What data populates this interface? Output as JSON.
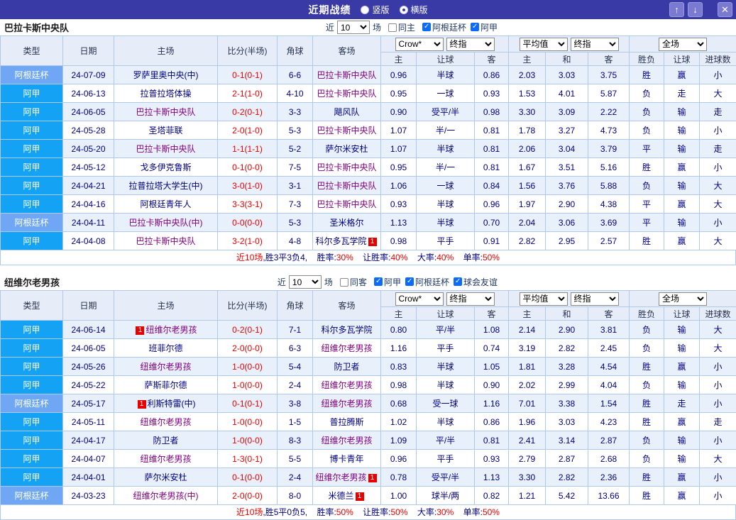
{
  "topbar": {
    "title": "近期战绩",
    "radios": [
      {
        "label": "竖版",
        "selected": false
      },
      {
        "label": "横版",
        "selected": true
      }
    ],
    "up_icon": "↑",
    "down_icon": "↓",
    "close_icon": "✕"
  },
  "table_header": {
    "type": "类型",
    "date": "日期",
    "home": "主场",
    "score": "比分(半场)",
    "corner": "角球",
    "away": "客场",
    "group1": {
      "dd1": "Crow*",
      "dd2": "终指"
    },
    "group2": {
      "dd1": "平均值",
      "dd2": "终指"
    },
    "group3": {
      "dd1": "全场"
    },
    "sub": [
      "主",
      "让球",
      "客",
      "主",
      "和",
      "客",
      "胜负",
      "让球",
      "进球数"
    ]
  },
  "sections": [
    {
      "team": "巴拉卡斯中央队",
      "filter": {
        "near": "近",
        "count": "10",
        "games": "场",
        "same": {
          "label": "同主",
          "checked": false
        },
        "leagues": [
          {
            "label": "阿根廷杯",
            "checked": true
          },
          {
            "label": "阿甲",
            "checked": true
          }
        ]
      },
      "rows": [
        {
          "type": "阿根廷杯",
          "cup": true,
          "date": "24-07-09",
          "home": {
            "name": "罗萨里奥中央(中)",
            "hl": false
          },
          "score": "0-1(0-1)",
          "corner": "6-6",
          "away": {
            "name": "巴拉卡斯中央队",
            "hl": true
          },
          "odds": [
            "0.96",
            "半球",
            "0.86",
            "2.03",
            "3.03",
            "3.75"
          ],
          "results": [
            [
              "胜",
              "r"
            ],
            [
              "赢",
              "r"
            ],
            [
              "小",
              "b"
            ]
          ]
        },
        {
          "type": "阿甲",
          "cup": false,
          "date": "24-06-13",
          "home": {
            "name": "拉普拉塔体操",
            "hl": false
          },
          "score": "2-1(1-0)",
          "corner": "4-10",
          "away": {
            "name": "巴拉卡斯中央队",
            "hl": true
          },
          "odds": [
            "0.95",
            "一球",
            "0.93",
            "1.53",
            "4.01",
            "5.87"
          ],
          "results": [
            [
              "负",
              "b"
            ],
            [
              "走",
              "g"
            ],
            [
              "大",
              "r"
            ]
          ]
        },
        {
          "type": "阿甲",
          "cup": false,
          "date": "24-06-05",
          "home": {
            "name": "巴拉卡斯中央队",
            "hl": true
          },
          "score": "0-2(0-1)",
          "corner": "3-3",
          "away": {
            "name": "飓风队",
            "hl": false
          },
          "odds": [
            "0.90",
            "受平/半",
            "0.98",
            "3.30",
            "3.09",
            "2.22"
          ],
          "results": [
            [
              "负",
              "b"
            ],
            [
              "输",
              "b"
            ],
            [
              "走",
              "g"
            ]
          ]
        },
        {
          "type": "阿甲",
          "cup": false,
          "date": "24-05-28",
          "home": {
            "name": "圣塔菲联",
            "hl": false
          },
          "score": "2-0(1-0)",
          "corner": "5-3",
          "away": {
            "name": "巴拉卡斯中央队",
            "hl": true
          },
          "odds": [
            "1.07",
            "半/一",
            "0.81",
            "1.78",
            "3.27",
            "4.73"
          ],
          "results": [
            [
              "负",
              "b"
            ],
            [
              "输",
              "b"
            ],
            [
              "小",
              "b"
            ]
          ]
        },
        {
          "type": "阿甲",
          "cup": false,
          "date": "24-05-20",
          "home": {
            "name": "巴拉卡斯中央队",
            "hl": true
          },
          "score": "1-1(1-1)",
          "corner": "5-2",
          "away": {
            "name": "萨尔米安杜",
            "hl": false
          },
          "odds": [
            "1.07",
            "半球",
            "0.81",
            "2.06",
            "3.04",
            "3.79"
          ],
          "results": [
            [
              "平",
              "b"
            ],
            [
              "输",
              "b"
            ],
            [
              "走",
              "g"
            ]
          ]
        },
        {
          "type": "阿甲",
          "cup": false,
          "date": "24-05-12",
          "home": {
            "name": "戈多伊克鲁斯",
            "hl": false
          },
          "score": "0-1(0-0)",
          "corner": "7-5",
          "away": {
            "name": "巴拉卡斯中央队",
            "hl": true
          },
          "odds": [
            "0.95",
            "半/一",
            "0.81",
            "1.67",
            "3.51",
            "5.16"
          ],
          "results": [
            [
              "胜",
              "r"
            ],
            [
              "赢",
              "r"
            ],
            [
              "小",
              "b"
            ]
          ]
        },
        {
          "type": "阿甲",
          "cup": false,
          "date": "24-04-21",
          "home": {
            "name": "拉普拉塔大学生(中)",
            "hl": false
          },
          "score": "3-0(1-0)",
          "corner": "3-1",
          "away": {
            "name": "巴拉卡斯中央队",
            "hl": true
          },
          "odds": [
            "1.06",
            "一球",
            "0.84",
            "1.56",
            "3.76",
            "5.88"
          ],
          "results": [
            [
              "负",
              "b"
            ],
            [
              "输",
              "b"
            ],
            [
              "大",
              "r"
            ]
          ]
        },
        {
          "type": "阿甲",
          "cup": false,
          "date": "24-04-16",
          "home": {
            "name": "阿根廷青年人",
            "hl": false
          },
          "score": "3-3(3-1)",
          "corner": "7-3",
          "away": {
            "name": "巴拉卡斯中央队",
            "hl": true
          },
          "odds": [
            "0.93",
            "半球",
            "0.96",
            "1.97",
            "2.90",
            "4.38"
          ],
          "results": [
            [
              "平",
              "b"
            ],
            [
              "赢",
              "r"
            ],
            [
              "大",
              "r"
            ]
          ]
        },
        {
          "type": "阿根廷杯",
          "cup": true,
          "date": "24-04-11",
          "home": {
            "name": "巴拉卡斯中央队(中)",
            "hl": true
          },
          "score": "0-0(0-0)",
          "corner": "5-3",
          "away": {
            "name": "圣米格尔",
            "hl": false
          },
          "odds": [
            "1.13",
            "半球",
            "0.70",
            "2.04",
            "3.06",
            "3.69"
          ],
          "results": [
            [
              "平",
              "b"
            ],
            [
              "输",
              "b"
            ],
            [
              "小",
              "b"
            ]
          ]
        },
        {
          "type": "阿甲",
          "cup": false,
          "date": "24-04-08",
          "home": {
            "name": "巴拉卡斯中央队",
            "hl": true
          },
          "score": "3-2(1-0)",
          "corner": "4-8",
          "away": {
            "name": "科尔多瓦学院",
            "hl": false,
            "card_post": "1"
          },
          "odds": [
            "0.98",
            "平手",
            "0.91",
            "2.82",
            "2.95",
            "2.57"
          ],
          "results": [
            [
              "胜",
              "r"
            ],
            [
              "赢",
              "r"
            ],
            [
              "大",
              "r"
            ]
          ]
        }
      ],
      "summary": {
        "prefix": "近10场",
        "record": ",胜3平3负4,",
        "stats": [
          {
            "label": "胜率:",
            "value": "30%"
          },
          {
            "label": "让胜率:",
            "value": "40%"
          },
          {
            "label": "大率:",
            "value": "40%"
          },
          {
            "label": "单率:",
            "value": "50%"
          }
        ]
      }
    },
    {
      "team": "纽维尔老男孩",
      "filter": {
        "near": "近",
        "count": "10",
        "games": "场",
        "same": {
          "label": "同客",
          "checked": false
        },
        "leagues": [
          {
            "label": "阿甲",
            "checked": true
          },
          {
            "label": "阿根廷杯",
            "checked": true
          },
          {
            "label": "球会友谊",
            "checked": true
          }
        ]
      },
      "rows": [
        {
          "type": "阿甲",
          "cup": false,
          "date": "24-06-14",
          "home": {
            "name": "纽维尔老男孩",
            "hl": true,
            "card_pre": "1"
          },
          "score": "0-2(0-1)",
          "corner": "7-1",
          "away": {
            "name": "科尔多瓦学院",
            "hl": false
          },
          "odds": [
            "0.80",
            "平/半",
            "1.08",
            "2.14",
            "2.90",
            "3.81"
          ],
          "results": [
            [
              "负",
              "b"
            ],
            [
              "输",
              "b"
            ],
            [
              "大",
              "r"
            ]
          ]
        },
        {
          "type": "阿甲",
          "cup": false,
          "date": "24-06-05",
          "home": {
            "name": "班菲尔德",
            "hl": false
          },
          "score": "2-0(0-0)",
          "corner": "6-3",
          "away": {
            "name": "纽维尔老男孩",
            "hl": true
          },
          "odds": [
            "1.16",
            "平手",
            "0.74",
            "3.19",
            "2.82",
            "2.45"
          ],
          "results": [
            [
              "负",
              "b"
            ],
            [
              "输",
              "b"
            ],
            [
              "大",
              "r"
            ]
          ]
        },
        {
          "type": "阿甲",
          "cup": false,
          "date": "24-05-26",
          "home": {
            "name": "纽维尔老男孩",
            "hl": true
          },
          "score": "1-0(0-0)",
          "corner": "5-4",
          "away": {
            "name": "防卫者",
            "hl": false
          },
          "odds": [
            "0.83",
            "半球",
            "1.05",
            "1.81",
            "3.28",
            "4.54"
          ],
          "results": [
            [
              "胜",
              "r"
            ],
            [
              "赢",
              "r"
            ],
            [
              "小",
              "b"
            ]
          ]
        },
        {
          "type": "阿甲",
          "cup": false,
          "date": "24-05-22",
          "home": {
            "name": "萨斯菲尔德",
            "hl": false
          },
          "score": "1-0(0-0)",
          "corner": "2-4",
          "away": {
            "name": "纽维尔老男孩",
            "hl": true
          },
          "odds": [
            "0.98",
            "半球",
            "0.90",
            "2.02",
            "2.99",
            "4.04"
          ],
          "results": [
            [
              "负",
              "b"
            ],
            [
              "输",
              "b"
            ],
            [
              "小",
              "b"
            ]
          ]
        },
        {
          "type": "阿根廷杯",
          "cup": true,
          "date": "24-05-17",
          "home": {
            "name": "利斯特雷(中)",
            "hl": false,
            "card_pre": "1"
          },
          "score": "0-1(0-1)",
          "corner": "3-8",
          "away": {
            "name": "纽维尔老男孩",
            "hl": true
          },
          "odds": [
            "0.68",
            "受一球",
            "1.16",
            "7.01",
            "3.38",
            "1.54"
          ],
          "results": [
            [
              "胜",
              "r"
            ],
            [
              "走",
              "g"
            ],
            [
              "小",
              "b"
            ]
          ]
        },
        {
          "type": "阿甲",
          "cup": false,
          "date": "24-05-11",
          "home": {
            "name": "纽维尔老男孩",
            "hl": true
          },
          "score": "1-0(0-0)",
          "corner": "1-5",
          "away": {
            "name": "普拉腾斯",
            "hl": false
          },
          "odds": [
            "1.02",
            "半球",
            "0.86",
            "1.96",
            "3.03",
            "4.23"
          ],
          "results": [
            [
              "胜",
              "r"
            ],
            [
              "赢",
              "r"
            ],
            [
              "走",
              "g"
            ]
          ]
        },
        {
          "type": "阿甲",
          "cup": false,
          "date": "24-04-17",
          "home": {
            "name": "防卫者",
            "hl": false
          },
          "score": "1-0(0-0)",
          "corner": "8-3",
          "away": {
            "name": "纽维尔老男孩",
            "hl": true
          },
          "odds": [
            "1.09",
            "平/半",
            "0.81",
            "2.41",
            "3.14",
            "2.87"
          ],
          "results": [
            [
              "负",
              "b"
            ],
            [
              "输",
              "b"
            ],
            [
              "小",
              "b"
            ]
          ]
        },
        {
          "type": "阿甲",
          "cup": false,
          "date": "24-04-07",
          "home": {
            "name": "纽维尔老男孩",
            "hl": true
          },
          "score": "1-3(0-1)",
          "corner": "5-5",
          "away": {
            "name": "博卡青年",
            "hl": false
          },
          "odds": [
            "0.96",
            "平手",
            "0.93",
            "2.79",
            "2.87",
            "2.68"
          ],
          "results": [
            [
              "负",
              "b"
            ],
            [
              "输",
              "b"
            ],
            [
              "大",
              "r"
            ]
          ]
        },
        {
          "type": "阿甲",
          "cup": false,
          "date": "24-04-01",
          "home": {
            "name": "萨尔米安杜",
            "hl": false
          },
          "score": "0-1(0-0)",
          "corner": "2-4",
          "away": {
            "name": "纽维尔老男孩",
            "hl": true,
            "card_post": "1"
          },
          "odds": [
            "0.78",
            "受平/半",
            "1.13",
            "3.30",
            "2.82",
            "2.36"
          ],
          "results": [
            [
              "胜",
              "r"
            ],
            [
              "赢",
              "r"
            ],
            [
              "小",
              "b"
            ]
          ]
        },
        {
          "type": "阿根廷杯",
          "cup": true,
          "date": "24-03-23",
          "home": {
            "name": "纽维尔老男孩(中)",
            "hl": true
          },
          "score": "2-0(0-0)",
          "corner": "8-0",
          "away": {
            "name": "米德兰",
            "hl": false,
            "card_post": "1"
          },
          "odds": [
            "1.00",
            "球半/两",
            "0.82",
            "1.21",
            "5.42",
            "13.66"
          ],
          "results": [
            [
              "胜",
              "r"
            ],
            [
              "赢",
              "r"
            ],
            [
              "小",
              "b"
            ]
          ]
        }
      ],
      "summary": {
        "prefix": "近10场",
        "record": ",胜5平0负5,",
        "stats": [
          {
            "label": "胜率:",
            "value": "50%"
          },
          {
            "label": "让胜率:",
            "value": "50%"
          },
          {
            "label": "大率:",
            "value": "30%"
          },
          {
            "label": "单率:",
            "value": "50%"
          }
        ]
      }
    }
  ]
}
